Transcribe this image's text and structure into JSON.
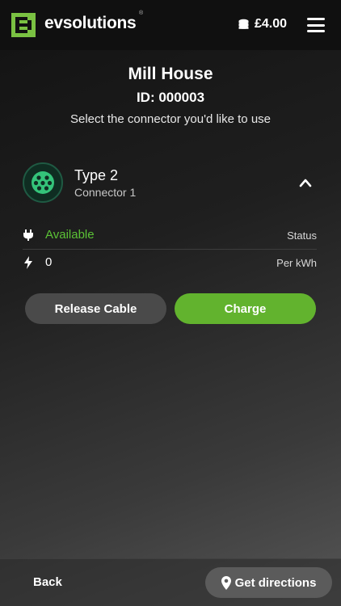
{
  "header": {
    "brand": "evsolutions",
    "brand_mark": "®",
    "balance": "£4.00",
    "icons": {
      "logo": "evsolutions-logo-icon",
      "coins": "coins-icon",
      "menu": "hamburger-menu-icon"
    }
  },
  "site": {
    "name": "Mill House",
    "id": "ID: 000003",
    "instruction": "Select the connector you'd like to use"
  },
  "connector": {
    "type": "Type 2",
    "label": "Connector 1",
    "icon": "type2-plug-icon",
    "expanded": true
  },
  "details": {
    "status_value": "Available",
    "status_label": "Status",
    "rate_value": "0",
    "rate_label": "Per kWh"
  },
  "actions": {
    "release": "Release Cable",
    "charge": "Charge"
  },
  "footer": {
    "back": "Back",
    "directions": "Get directions"
  },
  "colors": {
    "accent_green": "#62b32e",
    "status_green": "#5bc236",
    "brand_green": "#7ac142",
    "secondary_button": "#4a4a4a"
  }
}
